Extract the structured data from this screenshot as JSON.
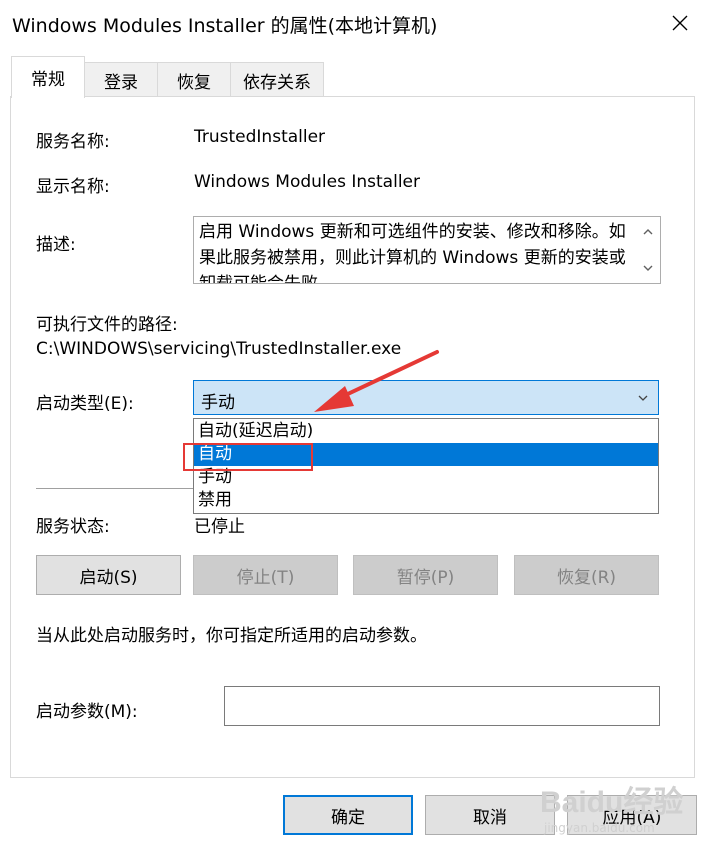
{
  "window": {
    "title": "Windows Modules Installer 的属性(本地计算机)"
  },
  "tabs": [
    {
      "label": "常规"
    },
    {
      "label": "登录"
    },
    {
      "label": "恢复"
    },
    {
      "label": "依存关系"
    }
  ],
  "general": {
    "service_name_label": "服务名称:",
    "service_name_value": "TrustedInstaller",
    "display_name_label": "显示名称:",
    "display_name_value": "Windows Modules Installer",
    "description_label": "描述:",
    "description_value": "启用 Windows 更新和可选组件的安装、修改和移除。如果此服务被禁用，则此计算机的 Windows 更新的安装或卸载可能会失败。",
    "exe_path_label": "可执行文件的路径:",
    "exe_path_value": "C:\\WINDOWS\\servicing\\TrustedInstaller.exe",
    "startup_type_label": "启动类型(E):",
    "startup_type_value": "手动",
    "startup_options": [
      "自动(延迟启动)",
      "自动",
      "手动",
      "禁用"
    ],
    "startup_highlighted": "自动",
    "service_status_label": "服务状态:",
    "service_status_value": "已停止",
    "buttons": {
      "start": "启动(S)",
      "stop": "停止(T)",
      "pause": "暂停(P)",
      "resume": "恢复(R)"
    },
    "hint_text": "当从此处启动服务时，你可指定所适用的启动参数。",
    "start_params_label": "启动参数(M):",
    "start_params_value": ""
  },
  "dialog_buttons": {
    "ok": "确定",
    "cancel": "取消",
    "apply": "应用(A)"
  },
  "watermark": {
    "logo": "Baidu经验",
    "sub": "jingyan.baidu.com"
  },
  "colors": {
    "accent": "#0078d7",
    "combo_bg": "#cce4f7",
    "annotation": "#e53935"
  }
}
